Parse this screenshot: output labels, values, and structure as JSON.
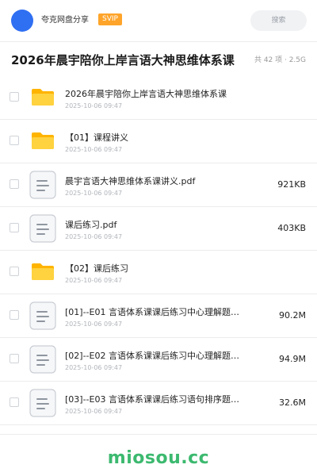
{
  "header": {
    "user_name": "夸克网盘分享",
    "badge": "SVIP",
    "search_label": "搜索",
    "colors": {
      "avatar": "#2f6ff2",
      "badge": "#ffa42a"
    }
  },
  "folder": {
    "title": "2026年晨宇陪你上岸言语大神思维体系课",
    "meta": "共 42 项 · 2.5G"
  },
  "files": [
    {
      "type": "folder",
      "icon": "folder-icon",
      "name": "2026年晨宇陪你上岸言语大神思维体系课",
      "date": "2025-10-06 09:47",
      "size": ""
    },
    {
      "type": "folder",
      "icon": "folder-icon",
      "name": "【01】课程讲义",
      "date": "2025-10-06 09:47",
      "size": ""
    },
    {
      "type": "file",
      "icon": "document-icon",
      "name": "晨宇言语大神思维体系课讲义.pdf",
      "date": "2025-10-06 09:47",
      "size": "921KB"
    },
    {
      "type": "file",
      "icon": "document-icon",
      "name": "课后练习.pdf",
      "date": "2025-10-06 09:47",
      "size": "403KB"
    },
    {
      "type": "folder",
      "icon": "folder-icon",
      "name": "【02】课后练习",
      "date": "2025-10-06 09:47",
      "size": ""
    },
    {
      "type": "file",
      "icon": "document-icon",
      "name": "[01]--E01 言语体系课课后练习中心理解题（…",
      "date": "2025-10-06 09:47",
      "size": "90.2M"
    },
    {
      "type": "file",
      "icon": "document-icon",
      "name": "[02]--E02 言语体系课课后练习中心理解题（…",
      "date": "2025-10-06 09:47",
      "size": "94.9M"
    },
    {
      "type": "file",
      "icon": "document-icon",
      "name": "[03]--E03 言语体系课课后练习语句排序题（…",
      "date": "2025-10-06 09:47",
      "size": "32.6M"
    }
  ],
  "watermark": "miosou.cc",
  "colors": {
    "folder": "#ffc21c",
    "folder_front": "#ffd33d",
    "watermark": "#3cb96f"
  }
}
